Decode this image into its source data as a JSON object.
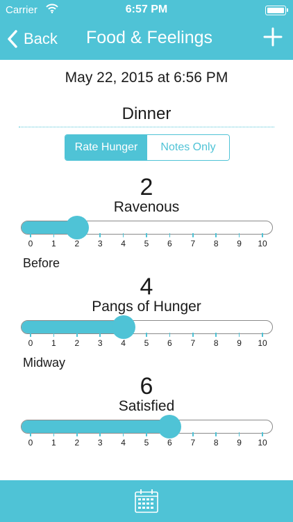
{
  "status_bar": {
    "carrier": "Carrier",
    "time": "6:57 PM"
  },
  "nav": {
    "back_label": "Back",
    "title": "Food & Feelings"
  },
  "entry": {
    "date": "May 22, 2015 at 6:56 PM",
    "meal": "Dinner"
  },
  "mode": {
    "options": [
      "Rate Hunger",
      "Notes Only"
    ],
    "selected": "Rate Hunger"
  },
  "scale": {
    "min": 0,
    "max": 10,
    "ticks": [
      "0",
      "1",
      "2",
      "3",
      "4",
      "5",
      "6",
      "7",
      "8",
      "9",
      "10"
    ]
  },
  "ratings": [
    {
      "phase": "Before",
      "value": "2",
      "level": 2,
      "description": "Ravenous"
    },
    {
      "phase": "Midway",
      "value": "4",
      "level": 4,
      "description": "Pangs of Hunger"
    },
    {
      "phase": "",
      "value": "6",
      "level": 6,
      "description": "Satisfied"
    }
  ],
  "colors": {
    "accent": "#4fc3d6",
    "text": "#1a1a1a",
    "track_border": "#8a8a8a"
  },
  "icons": {
    "back": "chevron-left-icon",
    "add": "plus-icon",
    "calendar": "calendar-icon",
    "wifi": "wifi-icon",
    "battery": "battery-icon"
  }
}
